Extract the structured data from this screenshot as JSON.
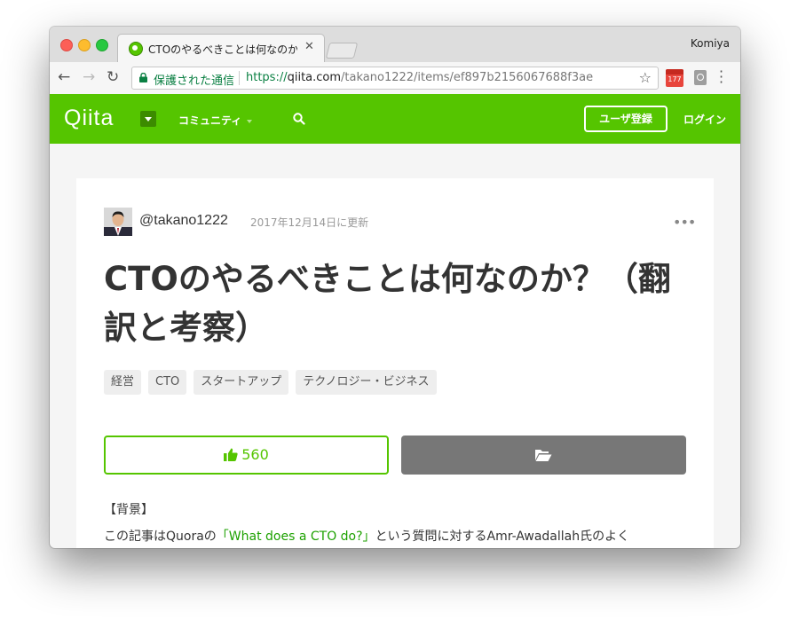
{
  "browser": {
    "tab_title": "CTOのやるべきことは何なのか？",
    "profile_name": "Komiya",
    "secure_label": "保護された通信",
    "url_scheme": "https://",
    "url_host": "qiita.com",
    "url_path": "/takano1222/items/ef897b2156067688f3ae",
    "calendar_badge": "177"
  },
  "header": {
    "logo": "Qiita",
    "community_label": "コミュニティ",
    "signup_label": "ユーザ登録",
    "login_label": "ログイン"
  },
  "article": {
    "author": "@takano1222",
    "updated": "2017年12月14日に更新",
    "title": "CTOのやるべきことは何なのか？（翻訳と考察）",
    "tags": [
      "経営",
      "CTO",
      "スタートアップ",
      "テクノロジー・ビジネス"
    ],
    "likes": "560",
    "body_heading": "【背景】",
    "body_prefix": "この記事はQuoraの",
    "body_link": "「What does a CTO do?」",
    "body_suffix": "という質問に対するAmr-Awadallah氏のよく"
  },
  "colors": {
    "brand_green": "#55c500",
    "link_green": "#1da100",
    "stock_gray": "#777777"
  }
}
